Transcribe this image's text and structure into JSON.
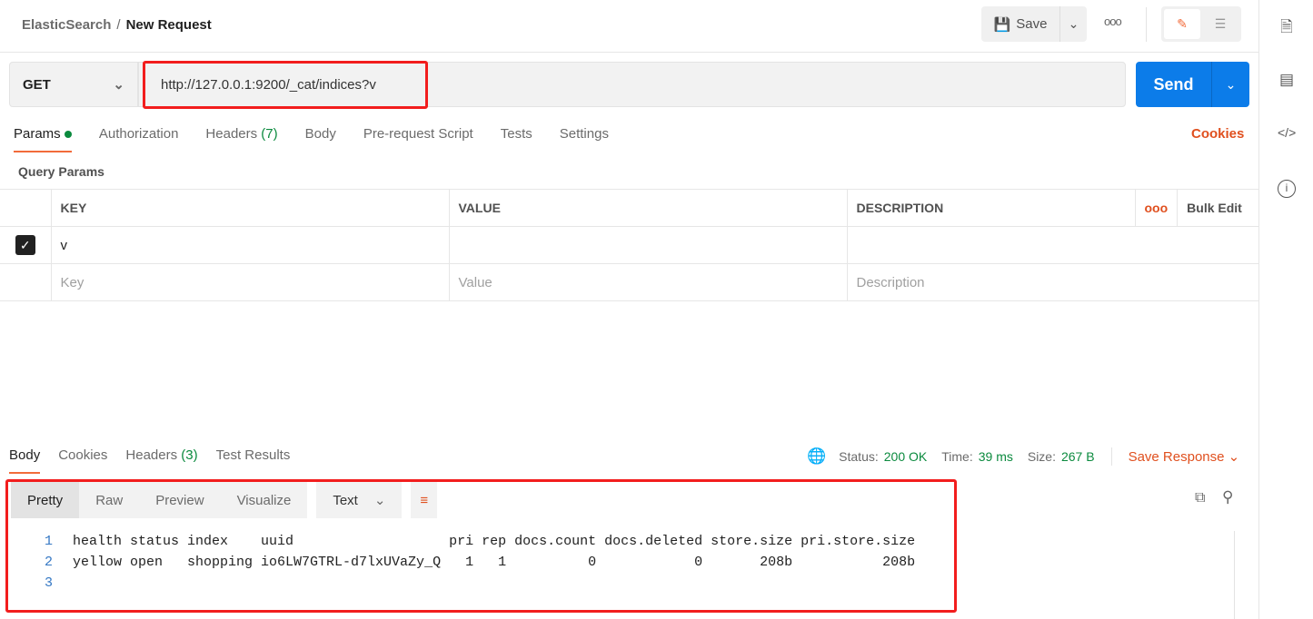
{
  "breadcrumb": {
    "parent": "ElasticSearch",
    "current": "New Request"
  },
  "toolbar": {
    "save_label": "Save"
  },
  "request": {
    "method": "GET",
    "url": "http://127.0.0.1:9200/_cat/indices?v",
    "send_label": "Send"
  },
  "tabs": [
    {
      "label": "Params"
    },
    {
      "label": "Authorization"
    },
    {
      "label": "Headers",
      "count": "(7)"
    },
    {
      "label": "Body"
    },
    {
      "label": "Pre-request Script"
    },
    {
      "label": "Tests"
    },
    {
      "label": "Settings"
    }
  ],
  "cookies_label": "Cookies",
  "query_params": {
    "title": "Query Params",
    "headers": [
      "KEY",
      "VALUE",
      "DESCRIPTION"
    ],
    "bulk_edit": "Bulk Edit",
    "rows": [
      {
        "checked": true,
        "key": "v",
        "value": "",
        "description": ""
      }
    ],
    "placeholders": {
      "key": "Key",
      "value": "Value",
      "description": "Description"
    }
  },
  "response": {
    "tabs": [
      {
        "label": "Body"
      },
      {
        "label": "Cookies"
      },
      {
        "label": "Headers",
        "count": "(3)"
      },
      {
        "label": "Test Results"
      }
    ],
    "status_label": "Status:",
    "status": "200 OK",
    "time_label": "Time:",
    "time": "39 ms",
    "size_label": "Size:",
    "size": "267 B",
    "save_response": "Save Response",
    "view_tabs": [
      "Pretty",
      "Raw",
      "Preview",
      "Visualize"
    ],
    "format": "Text",
    "lines": [
      {
        "n": "1",
        "text": "health status index    uuid                   pri rep docs.count docs.deleted store.size pri.store.size"
      },
      {
        "n": "2",
        "text": "yellow open   shopping io6LW7GTRL-d7lxUVaZy_Q   1   1          0            0       208b           208b"
      },
      {
        "n": "3",
        "text": ""
      }
    ]
  },
  "colors": {
    "accent": "#f26b3a",
    "send": "#0c7ce9",
    "success": "#0b8a3e",
    "highlight": "#f21d1d"
  }
}
